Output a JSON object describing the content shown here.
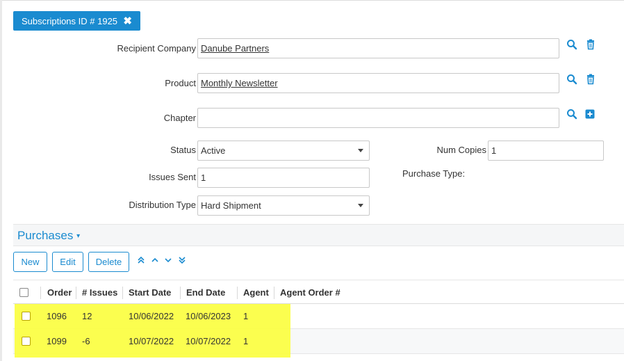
{
  "header": {
    "title": "Subscriptions ID # 1925",
    "close_glyph": "✖"
  },
  "form": {
    "recipient_company": {
      "label": "Recipient Company",
      "value": "Danube Partners"
    },
    "product": {
      "label": "Product",
      "value": "Monthly Newsletter"
    },
    "chapter": {
      "label": "Chapter",
      "value": ""
    },
    "status": {
      "label": "Status",
      "value": "Active"
    },
    "num_copies": {
      "label": "Num Copies",
      "value": "1"
    },
    "issues_sent": {
      "label": "Issues Sent",
      "value": "1"
    },
    "purchase_type": {
      "label": "Purchase Type:",
      "value": ""
    },
    "distribution_type": {
      "label": "Distribution Type",
      "value": "Hard Shipment"
    }
  },
  "purchases": {
    "title": "Purchases",
    "dropdown_glyph": "▾",
    "buttons": {
      "new": "New",
      "edit": "Edit",
      "delete": "Delete"
    },
    "columns": [
      "Order",
      "# Issues",
      "Start Date",
      "End Date",
      "Agent",
      "Agent Order #"
    ],
    "rows": [
      {
        "order": "1096",
        "issues": "12",
        "start": "10/06/2022",
        "end": "10/06/2023",
        "agent": "1",
        "agent_order": ""
      },
      {
        "order": "1099",
        "issues": "-6",
        "start": "10/07/2022",
        "end": "10/07/2022",
        "agent": "1",
        "agent_order": ""
      }
    ]
  },
  "colors": {
    "accent": "#1a8bd0",
    "highlight": "#fbfe3c"
  },
  "icons": [
    "close-icon",
    "search-icon",
    "trash-icon",
    "plus-square-icon",
    "move-top-icon",
    "move-up-icon",
    "move-down-icon",
    "move-bottom-icon",
    "dropdown-caret-icon"
  ]
}
